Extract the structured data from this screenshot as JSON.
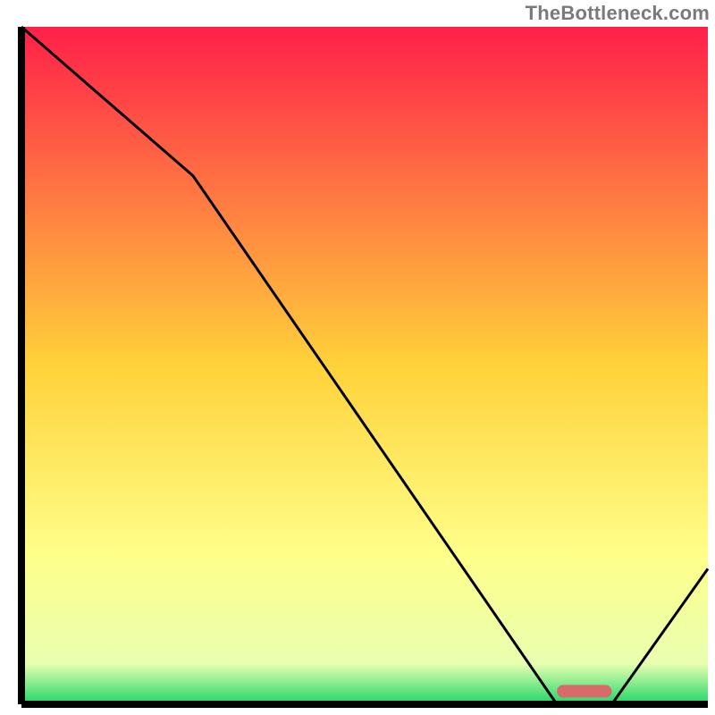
{
  "watermark": "TheBottleneck.com",
  "chart_data": {
    "type": "line",
    "title": "",
    "xlabel": "",
    "ylabel": "",
    "xlim": [
      0,
      100
    ],
    "ylim": [
      0,
      100
    ],
    "grid": false,
    "x": [
      0,
      25,
      78,
      86,
      100
    ],
    "values": [
      100,
      78,
      0,
      0,
      20
    ],
    "background_gradient": {
      "stops": [
        {
          "offset": 0.0,
          "color": "#ff1f4a"
        },
        {
          "offset": 0.5,
          "color": "#ffd23a"
        },
        {
          "offset": 0.78,
          "color": "#ffff8a"
        },
        {
          "offset": 0.94,
          "color": "#e8ffb0"
        },
        {
          "offset": 1.0,
          "color": "#1fd66a"
        }
      ]
    },
    "marker": {
      "x_start": 78,
      "x_end": 86,
      "y": 1,
      "color": "#d86a6a"
    },
    "line_color": "#000000",
    "border_color": "#000000"
  }
}
